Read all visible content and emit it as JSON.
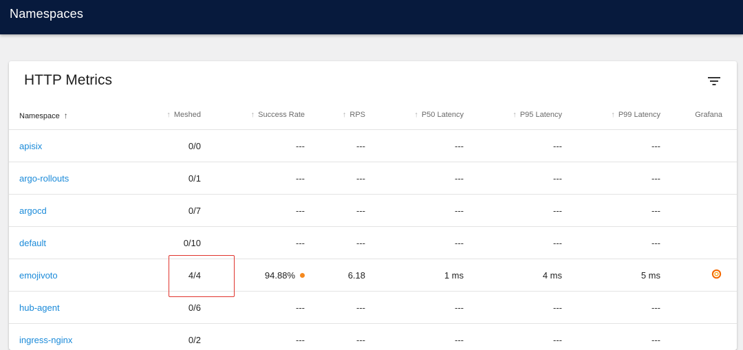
{
  "header": {
    "title": "Namespaces"
  },
  "card": {
    "title": "HTTP Metrics"
  },
  "columns": {
    "namespace": "Namespace",
    "meshed": "Meshed",
    "success_rate": "Success Rate",
    "rps": "RPS",
    "p50": "P50 Latency",
    "p95": "P95 Latency",
    "p99": "P99 Latency",
    "grafana": "Grafana"
  },
  "icons": {
    "filter": "filter-icon",
    "sort_active": "arrow-up-icon",
    "sort_inactive": "arrow-up-icon",
    "grafana": "grafana-icon",
    "status_dot": "status-dot"
  },
  "colors": {
    "header_bg": "#071a3d",
    "link": "#1a8ad9",
    "warning_dot": "#f5891f",
    "highlight_border": "#e0322b"
  },
  "rows": [
    {
      "namespace": "apisix",
      "meshed": "0/0",
      "success_rate": "---",
      "rps": "---",
      "p50": "---",
      "p95": "---",
      "p99": "---"
    },
    {
      "namespace": "argo-rollouts",
      "meshed": "0/1",
      "success_rate": "---",
      "rps": "---",
      "p50": "---",
      "p95": "---",
      "p99": "---"
    },
    {
      "namespace": "argocd",
      "meshed": "0/7",
      "success_rate": "---",
      "rps": "---",
      "p50": "---",
      "p95": "---",
      "p99": "---"
    },
    {
      "namespace": "default",
      "meshed": "0/10",
      "success_rate": "---",
      "rps": "---",
      "p50": "---",
      "p95": "---",
      "p99": "---"
    },
    {
      "namespace": "emojivoto",
      "meshed": "4/4",
      "success_rate": "94.88%",
      "rps": "6.18",
      "p50": "1 ms",
      "p95": "4 ms",
      "p99": "5 ms"
    },
    {
      "namespace": "hub-agent",
      "meshed": "0/6",
      "success_rate": "---",
      "rps": "---",
      "p50": "---",
      "p95": "---",
      "p99": "---"
    },
    {
      "namespace": "ingress-nginx",
      "meshed": "0/2",
      "success_rate": "---",
      "rps": "---",
      "p50": "---",
      "p95": "---",
      "p99": "---"
    }
  ]
}
